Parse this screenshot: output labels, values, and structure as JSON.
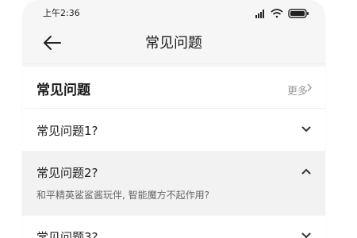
{
  "status": {
    "time": "上午2:36"
  },
  "nav": {
    "title": "常见问题"
  },
  "section": {
    "title": "常见问题",
    "more": "更多"
  },
  "faqs": [
    {
      "question": "常见问题1?",
      "expanded": false
    },
    {
      "question": "常见问题2?",
      "expanded": true,
      "answer": "和平精英鲨鲨酱玩伴, 智能魔方不起作用?"
    },
    {
      "question": "常见问题3?",
      "expanded": false
    }
  ],
  "colors": {
    "background": "#f6f6f6",
    "card": "#ffffff",
    "expanded_row": "#f2f2f2",
    "muted_text": "#9a9a9a"
  },
  "icons": [
    "signal-icon",
    "wifi-icon",
    "battery-icon",
    "back-arrow-icon",
    "chevron-right-icon",
    "chevron-down-icon",
    "chevron-up-icon"
  ]
}
